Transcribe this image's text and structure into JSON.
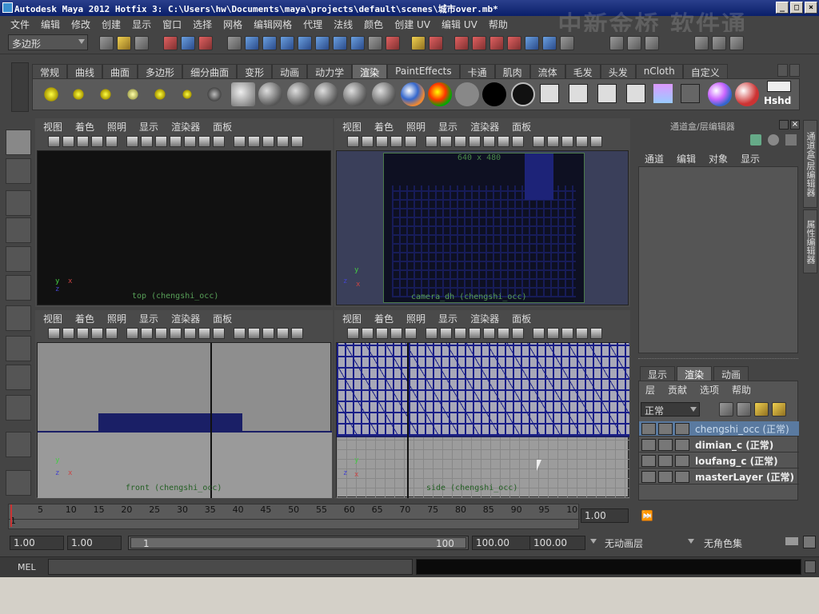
{
  "window": {
    "title": "Autodesk Maya 2012 Hotfix 3: C:\\Users\\hw\\Documents\\maya\\projects\\default\\scenes\\城市over.mb*",
    "min_label": "_",
    "max_label": "□",
    "close_label": "×"
  },
  "watermark": "中新金桥 软件通",
  "menubar": [
    "文件",
    "编辑",
    "修改",
    "创建",
    "显示",
    "窗口",
    "选择",
    "网格",
    "编辑网格",
    "代理",
    "法线",
    "颜色",
    "创建 UV",
    "编辑 UV",
    "帮助"
  ],
  "menuset": {
    "value": "多边形"
  },
  "shelf_tabs": [
    "常规",
    "曲线",
    "曲面",
    "多边形",
    "细分曲面",
    "变形",
    "动画",
    "动力学",
    "渲染",
    "PaintEffects",
    "卡通",
    "肌肉",
    "流体",
    "毛发",
    "头发",
    "nCloth",
    "自定义"
  ],
  "shelf_active": "渲染",
  "shelf_last_label": "Hshd",
  "viewports": {
    "menu": [
      "视图",
      "着色",
      "照明",
      "显示",
      "渲染器",
      "面板"
    ],
    "top": {
      "label": "top (chengshi_occ)"
    },
    "persp": {
      "label": "camera_dh (chengshi_occ)",
      "resolution": "640 x 480"
    },
    "front": {
      "label": "front (chengshi_occ)"
    },
    "side": {
      "label": "side (chengshi_occ)"
    }
  },
  "axes": {
    "x": "x",
    "y": "y",
    "z": "z"
  },
  "channel_box": {
    "title": "通道盒/层编辑器",
    "menu": [
      "通道",
      "编辑",
      "对象",
      "显示"
    ]
  },
  "layer_editor": {
    "tabs": [
      "显示",
      "渲染",
      "动画"
    ],
    "active_tab": "渲染",
    "menu": [
      "层",
      "贡献",
      "选项",
      "帮助"
    ],
    "mode": "正常",
    "layers": [
      {
        "name": "chengshi_occ (正常)",
        "selected": true
      },
      {
        "name": "dimian_c (正常)",
        "selected": false
      },
      {
        "name": "loufang_c (正常)",
        "selected": false
      },
      {
        "name": "masterLayer (正常)",
        "selected": false
      }
    ]
  },
  "side_tabs": [
    "通道盒/层编辑器",
    "属性编辑器"
  ],
  "timeline": {
    "ticks": [
      "5",
      "10",
      "15",
      "20",
      "25",
      "30",
      "35",
      "40",
      "45",
      "50",
      "55",
      "60",
      "65",
      "70",
      "75",
      "80",
      "85",
      "90",
      "95",
      "10"
    ],
    "start_label": "1",
    "current_frame": "1.00"
  },
  "range": {
    "start": "1.00",
    "playback_start": "1.00",
    "slider_start": "1",
    "slider_end": "100",
    "playback_end": "100.00",
    "end": "100.00",
    "anim_layer": "无动画层",
    "char_set": "无角色集"
  },
  "cmdline": {
    "label": "MEL"
  }
}
